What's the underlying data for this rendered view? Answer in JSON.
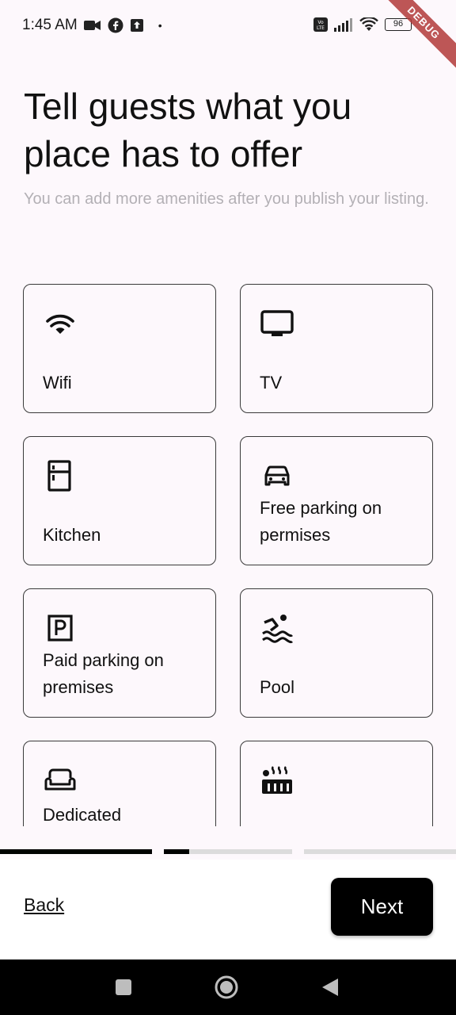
{
  "status_bar": {
    "time": "1:45 AM",
    "battery": "96"
  },
  "debug_banner": "DEBUG",
  "header": {
    "title": "Tell guests what you place has to offer",
    "subtitle": "You can add more amenities after you publish your listing."
  },
  "amenities": [
    {
      "label": "Wifi",
      "icon": "wifi-icon"
    },
    {
      "label": "TV",
      "icon": "tv-icon"
    },
    {
      "label": "Kitchen",
      "icon": "kitchen-icon"
    },
    {
      "label": "Free parking on permises",
      "icon": "car-icon"
    },
    {
      "label": "Paid parking on premises",
      "icon": "parking-icon"
    },
    {
      "label": "Pool",
      "icon": "pool-icon"
    },
    {
      "label": "Dedicated",
      "icon": "sofa-icon"
    },
    {
      "label": "",
      "icon": "hot-tub-icon"
    }
  ],
  "progress": {
    "segments": [
      1.0,
      0.2,
      0.0
    ]
  },
  "footer": {
    "back_label": "Back",
    "next_label": "Next"
  },
  "colors": {
    "accent": "#000000",
    "background": "#fdf8fc",
    "subtitle": "#b3b0b5"
  }
}
